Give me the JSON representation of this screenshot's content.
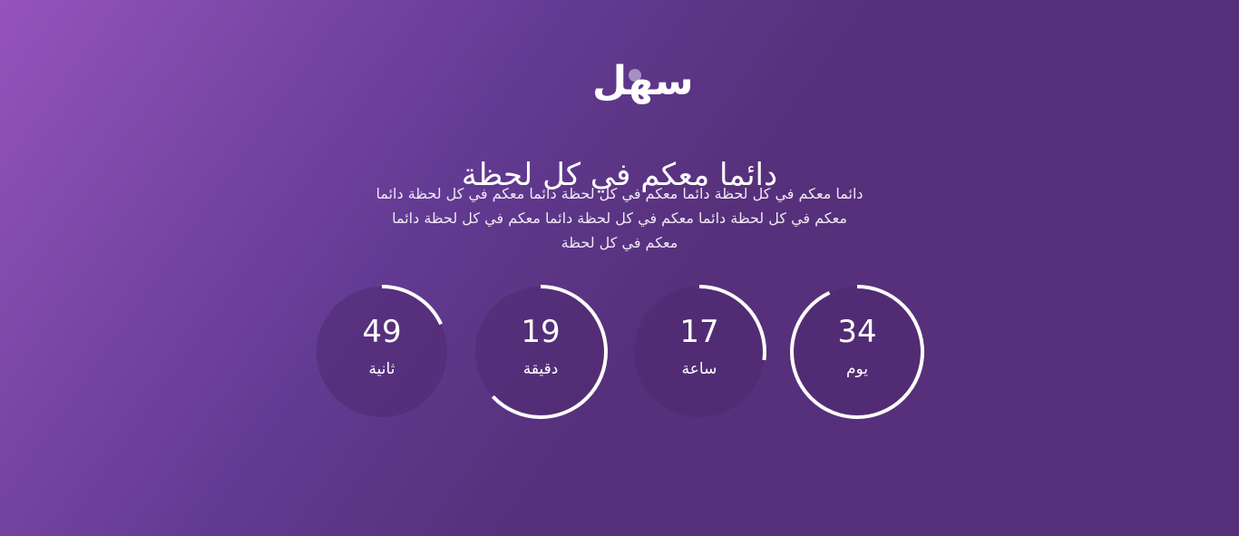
{
  "brand": {
    "logo_text": "سهل"
  },
  "hero": {
    "headline": "دائما معكم في كل لحظة",
    "description_lines": [
      "دائما معكم في كل لحظة دائما معكم في كل لحظة دائما معكم في كل لحظة دائما",
      "معكم في كل لحظة دائما معكم في كل لحظة دائما معكم في كل لحظة دائما",
      "معكم في كل لحظة"
    ]
  },
  "countdown": [
    {
      "value": "34",
      "label": "يوم",
      "progress": 0.93
    },
    {
      "value": "17",
      "label": "ساعة",
      "progress": 0.27
    },
    {
      "value": "19",
      "label": "دقيقة",
      "progress": 0.63
    },
    {
      "value": "49",
      "label": "ثانية",
      "progress": 0.18
    }
  ],
  "colors": {
    "gradient_start": "#9553bd",
    "gradient_end": "#56307a",
    "ring": "#ffffff",
    "disc": "#4f2a6f"
  }
}
